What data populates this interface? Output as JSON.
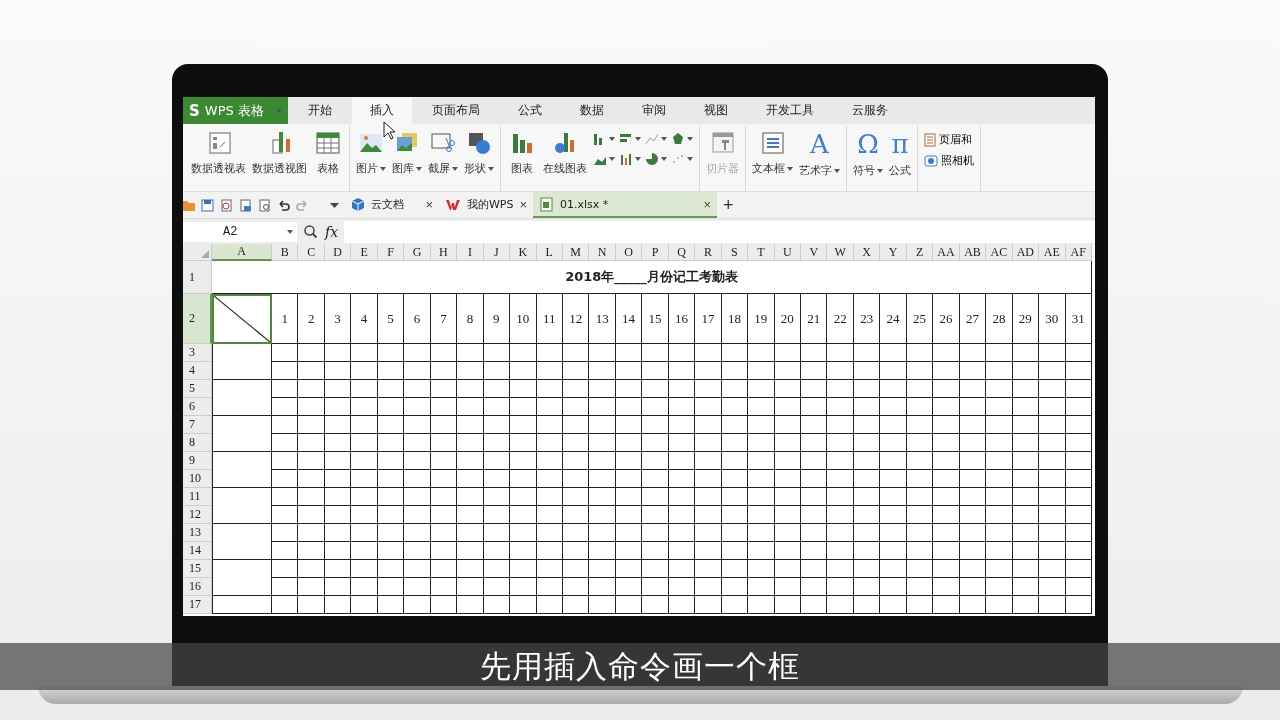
{
  "app_button": {
    "logo": "S",
    "label": "WPS 表格"
  },
  "menu_tabs": [
    {
      "label": "开始",
      "selected": false
    },
    {
      "label": "插入",
      "selected": true
    },
    {
      "label": "页面布局",
      "selected": false
    },
    {
      "label": "公式",
      "selected": false
    },
    {
      "label": "数据",
      "selected": false
    },
    {
      "label": "审阅",
      "selected": false
    },
    {
      "label": "视图",
      "selected": false
    },
    {
      "label": "开发工具",
      "selected": false
    },
    {
      "label": "云服务",
      "selected": false
    }
  ],
  "ribbon": [
    {
      "items": [
        {
          "kind": "large",
          "label": "数据透视表",
          "has_menu": false
        },
        {
          "kind": "large",
          "label": "数据透视图",
          "has_menu": false
        },
        {
          "kind": "large",
          "label": "表格",
          "has_menu": false
        }
      ]
    },
    {
      "items": [
        {
          "kind": "large",
          "label": "图片",
          "has_menu": true
        },
        {
          "kind": "large",
          "label": "图库",
          "has_menu": true
        },
        {
          "kind": "large",
          "label": "截屏",
          "has_menu": true
        },
        {
          "kind": "large",
          "label": "形状",
          "has_menu": true
        }
      ]
    },
    {
      "items": [
        {
          "kind": "large",
          "label": "图表",
          "has_menu": false
        },
        {
          "kind": "large",
          "label": "在线图表",
          "has_menu": false
        },
        {
          "kind": "chart_gallery"
        }
      ]
    },
    {
      "items": [
        {
          "kind": "large",
          "label": "切片器",
          "has_menu": false,
          "disabled": true
        }
      ]
    },
    {
      "items": [
        {
          "kind": "large",
          "label": "文本框",
          "has_menu": true
        },
        {
          "kind": "large",
          "label": "艺术字",
          "has_menu": true,
          "glyph": "A"
        }
      ]
    },
    {
      "items": [
        {
          "kind": "large",
          "label": "符号",
          "has_menu": true,
          "glyph": "Ω"
        },
        {
          "kind": "large",
          "label": "公式",
          "has_menu": false,
          "glyph": "π"
        }
      ]
    },
    {
      "items": [
        {
          "kind": "small",
          "label": "页眉和"
        },
        {
          "kind": "small",
          "label": "照相机"
        }
      ]
    }
  ],
  "doc_tabs": [
    {
      "label": "云文档",
      "close": "×",
      "selected": false
    },
    {
      "label": "我的WPS",
      "close": "×",
      "selected": false
    },
    {
      "label": "01.xlsx *",
      "close": "×",
      "selected": true
    }
  ],
  "new_tab": "+",
  "name_box": "A2",
  "fx": "fx",
  "sheet": {
    "columns": [
      {
        "label": "A",
        "selected": true
      },
      {
        "label": "B",
        "selected": false
      },
      {
        "label": "C",
        "selected": false
      },
      {
        "label": "D",
        "selected": false
      },
      {
        "label": "E",
        "selected": false
      },
      {
        "label": "F",
        "selected": false
      },
      {
        "label": "G",
        "selected": false
      },
      {
        "label": "H",
        "selected": false
      },
      {
        "label": "I",
        "selected": false
      },
      {
        "label": "J",
        "selected": false
      },
      {
        "label": "K",
        "selected": false
      },
      {
        "label": "L",
        "selected": false
      },
      {
        "label": "M",
        "selected": false
      },
      {
        "label": "N",
        "selected": false
      },
      {
        "label": "O",
        "selected": false
      },
      {
        "label": "P",
        "selected": false
      },
      {
        "label": "Q",
        "selected": false
      },
      {
        "label": "R",
        "selected": false
      },
      {
        "label": "S",
        "selected": false
      },
      {
        "label": "T",
        "selected": false
      },
      {
        "label": "U",
        "selected": false
      },
      {
        "label": "V",
        "selected": false
      },
      {
        "label": "W",
        "selected": false
      },
      {
        "label": "X",
        "selected": false
      },
      {
        "label": "Y",
        "selected": false
      },
      {
        "label": "Z",
        "selected": false
      },
      {
        "label": "AA",
        "selected": false
      },
      {
        "label": "AB",
        "selected": false
      },
      {
        "label": "AC",
        "selected": false
      },
      {
        "label": "AD",
        "selected": false
      },
      {
        "label": "AE",
        "selected": false
      },
      {
        "label": "AF",
        "selected": false
      }
    ],
    "rows": [
      {
        "label": "1",
        "selected": false
      },
      {
        "label": "2",
        "selected": true
      },
      {
        "label": "3",
        "selected": false
      },
      {
        "label": "4",
        "selected": false
      },
      {
        "label": "5",
        "selected": false
      },
      {
        "label": "6",
        "selected": false
      },
      {
        "label": "7",
        "selected": false
      },
      {
        "label": "8",
        "selected": false
      },
      {
        "label": "9",
        "selected": false
      },
      {
        "label": "10",
        "selected": false
      },
      {
        "label": "11",
        "selected": false
      },
      {
        "label": "12",
        "selected": false
      },
      {
        "label": "13",
        "selected": false
      },
      {
        "label": "14",
        "selected": false
      },
      {
        "label": "15",
        "selected": false
      },
      {
        "label": "16",
        "selected": false
      },
      {
        "label": "17",
        "selected": false
      }
    ],
    "title": "2018年_____月份记工考勤表",
    "days": [
      "1",
      "2",
      "3",
      "4",
      "5",
      "6",
      "7",
      "8",
      "9",
      "10",
      "11",
      "12",
      "13",
      "14",
      "15",
      "16",
      "17",
      "18",
      "19",
      "20",
      "21",
      "22",
      "23",
      "24",
      "25",
      "26",
      "27",
      "28",
      "29",
      "30",
      "31"
    ]
  },
  "subtitle": "先用插入命令画一个框"
}
